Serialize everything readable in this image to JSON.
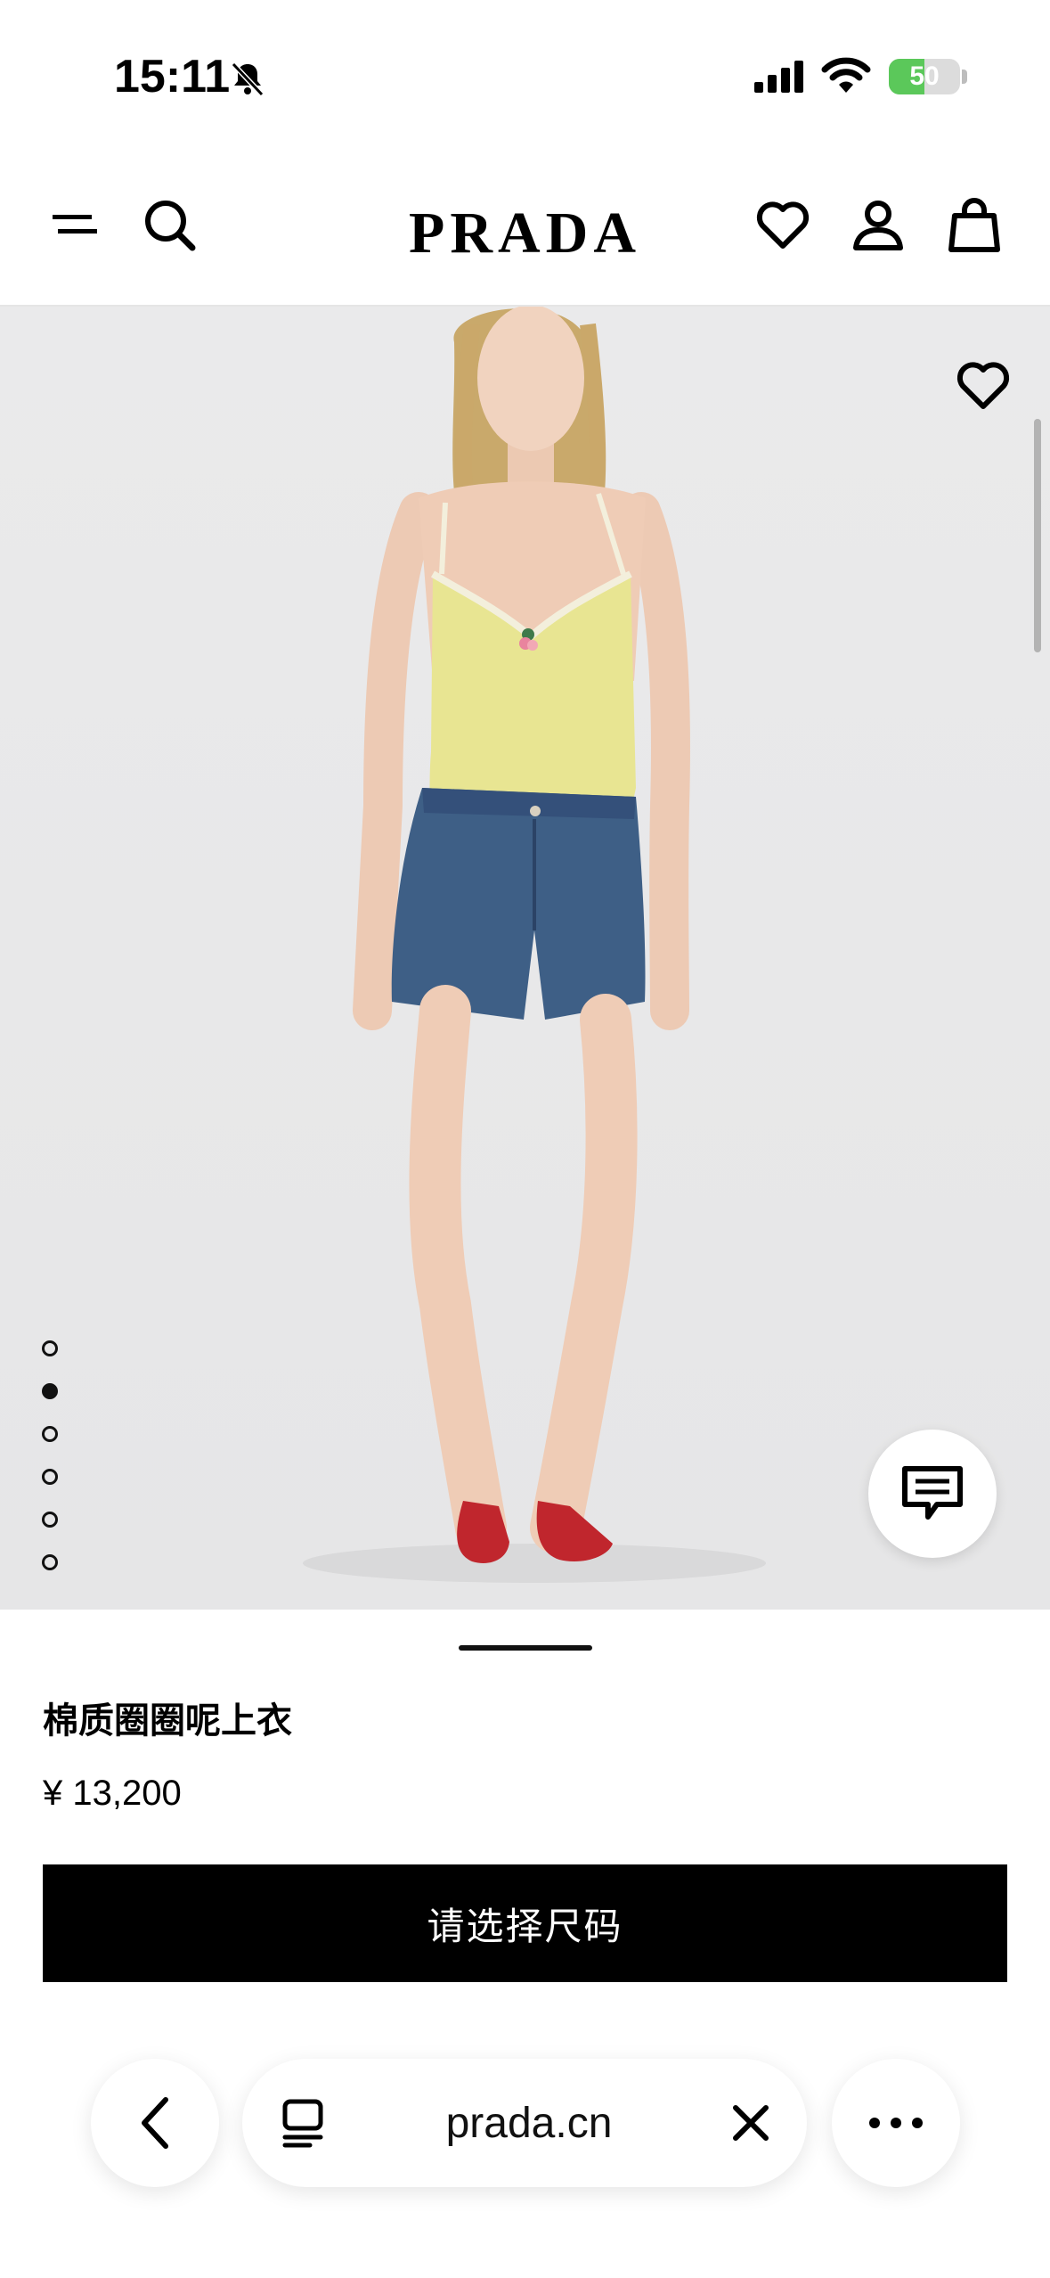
{
  "status_bar": {
    "time": "15:11",
    "battery": "50",
    "battery_level": 0.5
  },
  "header": {
    "brand": "PRADA"
  },
  "icons": {
    "menu": "menu-icon",
    "search": "search-icon",
    "wishlist": "heart-icon",
    "account": "user-icon",
    "bag": "shopping-bag-icon",
    "chat": "chat-icon"
  },
  "gallery": {
    "image_count": 6,
    "active_index": 1
  },
  "product": {
    "name": "棉质圈圈呢上衣",
    "price": "¥ 13,200",
    "select_size_label": "请选择尺码"
  },
  "browser": {
    "url": "prada.cn"
  },
  "colors": {
    "primary": "#000000",
    "battery_green": "#5bc85a",
    "top_yellow": "#e8e592",
    "denim": "#3e5f86",
    "shoes_red": "#c0262d"
  }
}
